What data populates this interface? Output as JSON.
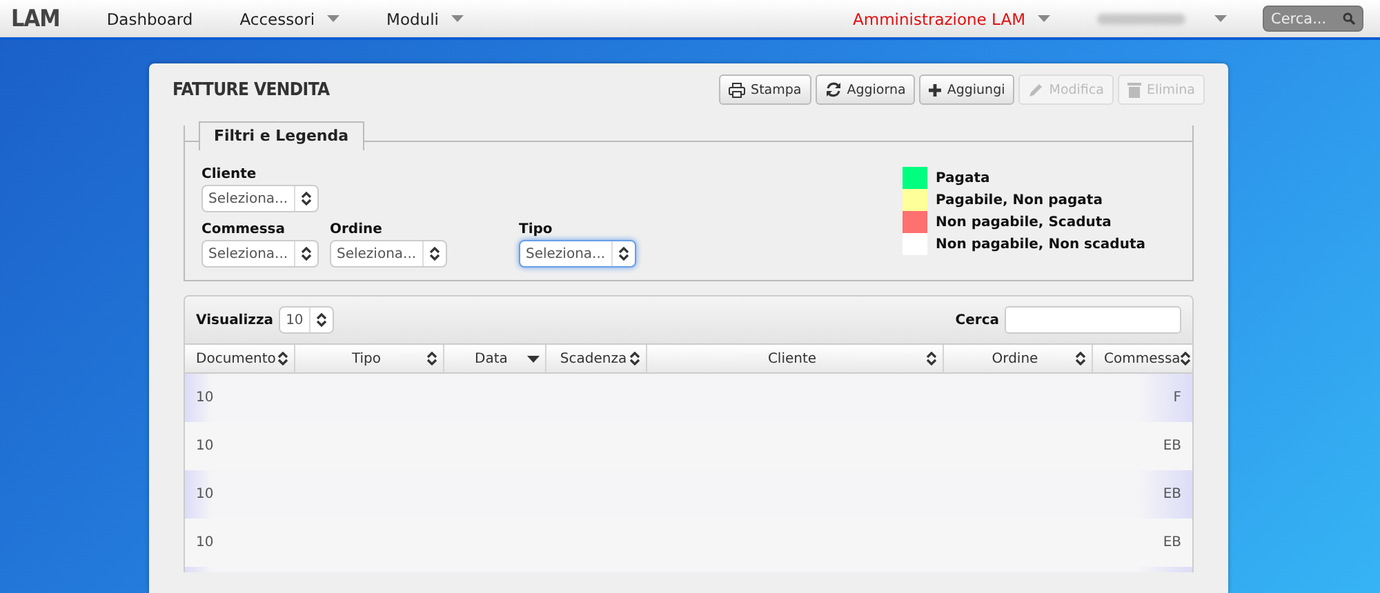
{
  "navbar": {
    "brand": "LAM",
    "items": [
      {
        "label": "Dashboard",
        "dropdown": false
      },
      {
        "label": "Accessori",
        "dropdown": true
      },
      {
        "label": "Moduli",
        "dropdown": true
      }
    ],
    "admin": {
      "label": "Amministrazione LAM"
    },
    "search": {
      "placeholder": "Cerca..."
    }
  },
  "panel": {
    "title": "FATTURE VENDITA",
    "buttons": [
      {
        "label": "Stampa",
        "disabled": false
      },
      {
        "label": "Aggiorna",
        "disabled": false
      },
      {
        "label": "Aggiungi",
        "disabled": false
      },
      {
        "label": "Modifica",
        "disabled": true
      },
      {
        "label": "Elimina",
        "disabled": true
      }
    ],
    "filters": {
      "legend": "Filtri e Legenda",
      "fields": [
        {
          "label": "Cliente",
          "placeholder": "Seleziona...",
          "focused": false
        },
        {
          "label": "Commessa",
          "placeholder": "Seleziona...",
          "focused": false
        },
        {
          "label": "Ordine",
          "placeholder": "Seleziona...",
          "focused": false
        },
        {
          "label": "Tipo",
          "placeholder": "Seleziona...",
          "focused": true
        }
      ],
      "legend_items": [
        {
          "label": "Pagata",
          "color": "#00ff80"
        },
        {
          "label": "Pagabile, Non pagata",
          "color": "#ffff99"
        },
        {
          "label": "Non pagabile, Scaduta",
          "color": "#ff7070"
        },
        {
          "label": "Non pagabile, Non scaduta",
          "color": "#ffffff"
        }
      ]
    },
    "table": {
      "length_label": "Visualizza",
      "length_value": "10",
      "search_label": "Cerca",
      "columns": [
        {
          "label": "Documento",
          "sorted": false
        },
        {
          "label": "Tipo",
          "sorted": false
        },
        {
          "label": "Data",
          "sorted": true
        },
        {
          "label": "Scadenza",
          "sorted": false
        },
        {
          "label": "Cliente",
          "sorted": false
        },
        {
          "label": "Ordine",
          "sorted": false
        },
        {
          "label": "Commessa",
          "sorted": false
        }
      ],
      "rows": [
        {
          "documento": "10",
          "commessa": "F"
        },
        {
          "documento": "10",
          "commessa": "EB"
        },
        {
          "documento": "10",
          "commessa": "EB"
        },
        {
          "documento": "10",
          "commessa": "EB"
        }
      ]
    }
  }
}
